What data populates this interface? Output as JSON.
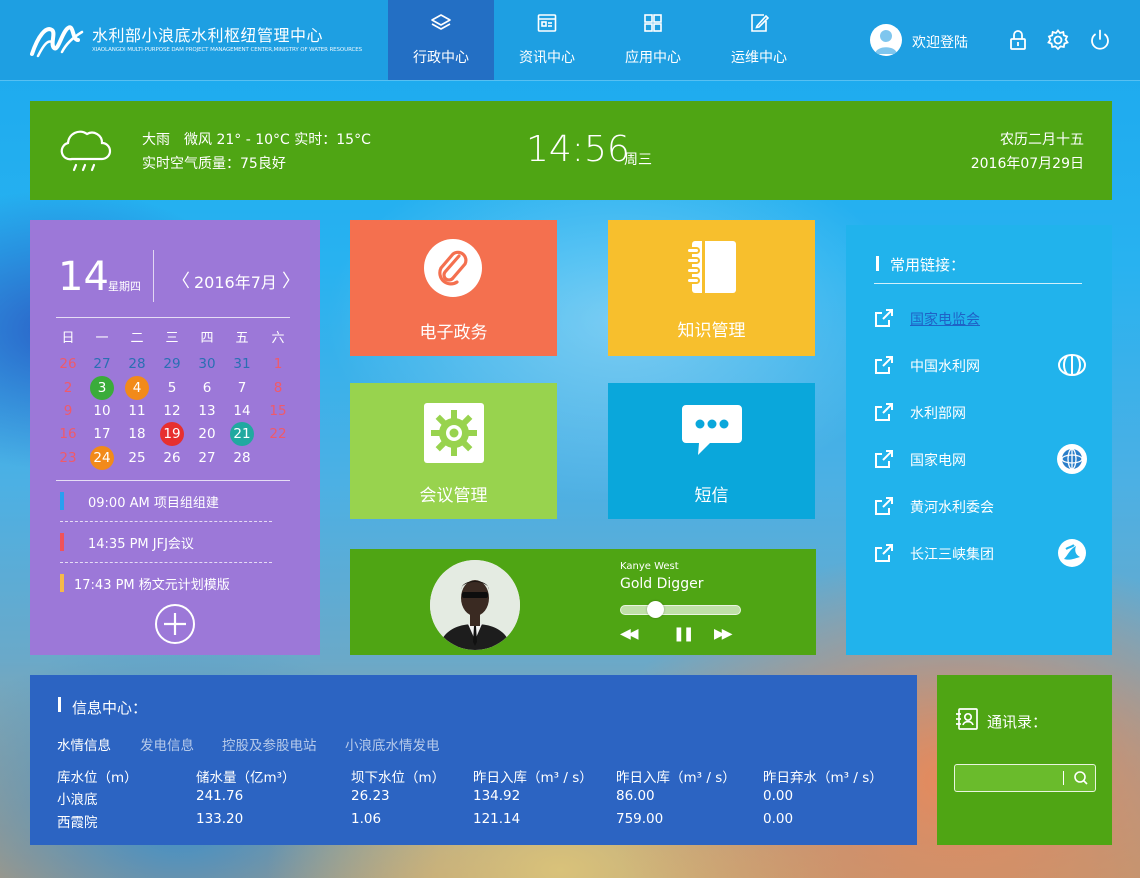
{
  "header": {
    "title": "水利部小浪底水利枢纽管理中心",
    "subtitle": "XIAOLANGDI MULTI-PURPOSE DAM PROJECT MANAGEMENT CENTER,MINISTRY OF WATER RESOURCES",
    "tabs": [
      {
        "label": "行政中心",
        "icon": "layers-icon",
        "active": true
      },
      {
        "label": "资讯中心",
        "icon": "news-icon",
        "active": false
      },
      {
        "label": "应用中心",
        "icon": "grid-icon",
        "active": false
      },
      {
        "label": "运维中心",
        "icon": "edit-icon",
        "active": false
      }
    ],
    "welcome": "欢迎登陆",
    "icons": [
      "lock-icon",
      "gear-icon",
      "power-icon"
    ],
    "colors": {
      "bar": "#1e9fe2",
      "active_tab": "#236fc4"
    }
  },
  "weather": {
    "icon": "rain-cloud-icon",
    "line1": "大雨　微风 21° - 10°C  实时：15°C",
    "line2": "实时空气质量：75良好",
    "time": "14:56",
    "weekday": "周三",
    "lunar": "农历二月十五",
    "date": "2016年07月29日",
    "color": "#4fa514"
  },
  "calendar": {
    "day": "14",
    "weekday": "星期四",
    "month": "2016年7月",
    "prev": "〈",
    "next": "〉",
    "weekdays": [
      "日",
      "一",
      "二",
      "三",
      "四",
      "五",
      "六"
    ],
    "weeks": [
      [
        "26",
        "27",
        "28",
        "29",
        "30",
        "31",
        "1"
      ],
      [
        "2",
        "3",
        "4",
        "5",
        "6",
        "7",
        "8"
      ],
      [
        "9",
        "10",
        "11",
        "12",
        "13",
        "14",
        "15"
      ],
      [
        "16",
        "17",
        "18",
        "19",
        "20",
        "21",
        "22"
      ],
      [
        "23",
        "24",
        "25",
        "26",
        "27",
        "28",
        ""
      ]
    ],
    "highlights": {
      "1-1": "#3aac3a",
      "1-2": "#f28a1a",
      "3-3": "#e7302f",
      "3-5": "#21a9a0",
      "4-1": "#f28a1a"
    },
    "events": [
      {
        "text": "09:00  AM  项目组组建",
        "color": "#2a9ff0"
      },
      {
        "text": "14:35  PM  JFJ会议",
        "color": "#f0525a"
      },
      {
        "text": "17:43  PM  杨文元计划模版",
        "color": "#f5b94a"
      }
    ],
    "add_icon": "plus-circle-icon",
    "color": "#9c78d8"
  },
  "tiles": [
    {
      "label": "电子政务",
      "icon": "paperclip-icon",
      "color": "#f4704f"
    },
    {
      "label": "知识管理",
      "icon": "notebook-icon",
      "color": "#f7bf2d"
    },
    {
      "label": "会议管理",
      "icon": "gear-icon",
      "color": "#98d34e"
    },
    {
      "label": "短信",
      "icon": "chat-bubble-icon",
      "color": "#0aa7db"
    }
  ],
  "player": {
    "artist": "Kanye West",
    "song": "Gold Digger",
    "progress": 0.29,
    "prev": "◀◀",
    "pause": "❚❚",
    "next": "▶▶"
  },
  "links": {
    "title": "常用链接：",
    "items": [
      {
        "label": "国家电监会",
        "logo": ""
      },
      {
        "label": "中国水利网",
        "logo": "water-logo-icon"
      },
      {
        "label": "水利部网",
        "logo": ""
      },
      {
        "label": "国家电网",
        "logo": "grid-globe-logo-icon"
      },
      {
        "label": "黄河水利委会",
        "logo": ""
      },
      {
        "label": "长江三峡集团",
        "logo": "three-gorges-logo-icon"
      }
    ],
    "color": "#21b3ec"
  },
  "info": {
    "title": "信息中心：",
    "tabs": [
      "水情信息",
      "发电信息",
      "控股及参股电站",
      "小浪底水情发电"
    ],
    "columns": [
      "库水位（m）",
      "储水量（亿m³）",
      "坝下水位（m）",
      "昨日入库（m³ / s）",
      "昨日入库（m³ / s）",
      "昨日弃水（m³ / s）"
    ],
    "rows": [
      [
        "小浪底",
        "241.76",
        "26.23",
        "134.92",
        "86.00",
        "0.00"
      ],
      [
        "西霞院",
        "133.20",
        "1.06",
        "121.14",
        "759.00",
        "0.00"
      ]
    ],
    "color": "#2c64c2"
  },
  "contacts": {
    "title": "通讯录：",
    "placeholder": "",
    "icon": "contacts-book-icon",
    "search_icon": "search-icon"
  }
}
